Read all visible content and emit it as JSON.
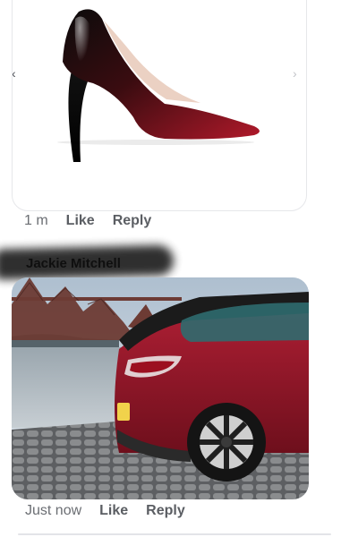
{
  "comment1": {
    "image": {
      "subject": "red gradient stiletto pump",
      "colors": {
        "top": "#111111",
        "bottom": "#a01622"
      }
    },
    "time": "1 m",
    "like_label": "Like",
    "reply_label": "Reply"
  },
  "comment2": {
    "author": "Jackie Mitchell",
    "image": {
      "subject": "red car in front of bridge",
      "colors": {
        "car": "#a3192e",
        "sky": "#c6d3df",
        "bridge": "#6d3b34"
      }
    },
    "time": "Just now",
    "like_label": "Like",
    "reply_label": "Reply"
  },
  "icons": {
    "prev": "chevron-left-icon",
    "next": "chevron-right-icon"
  }
}
